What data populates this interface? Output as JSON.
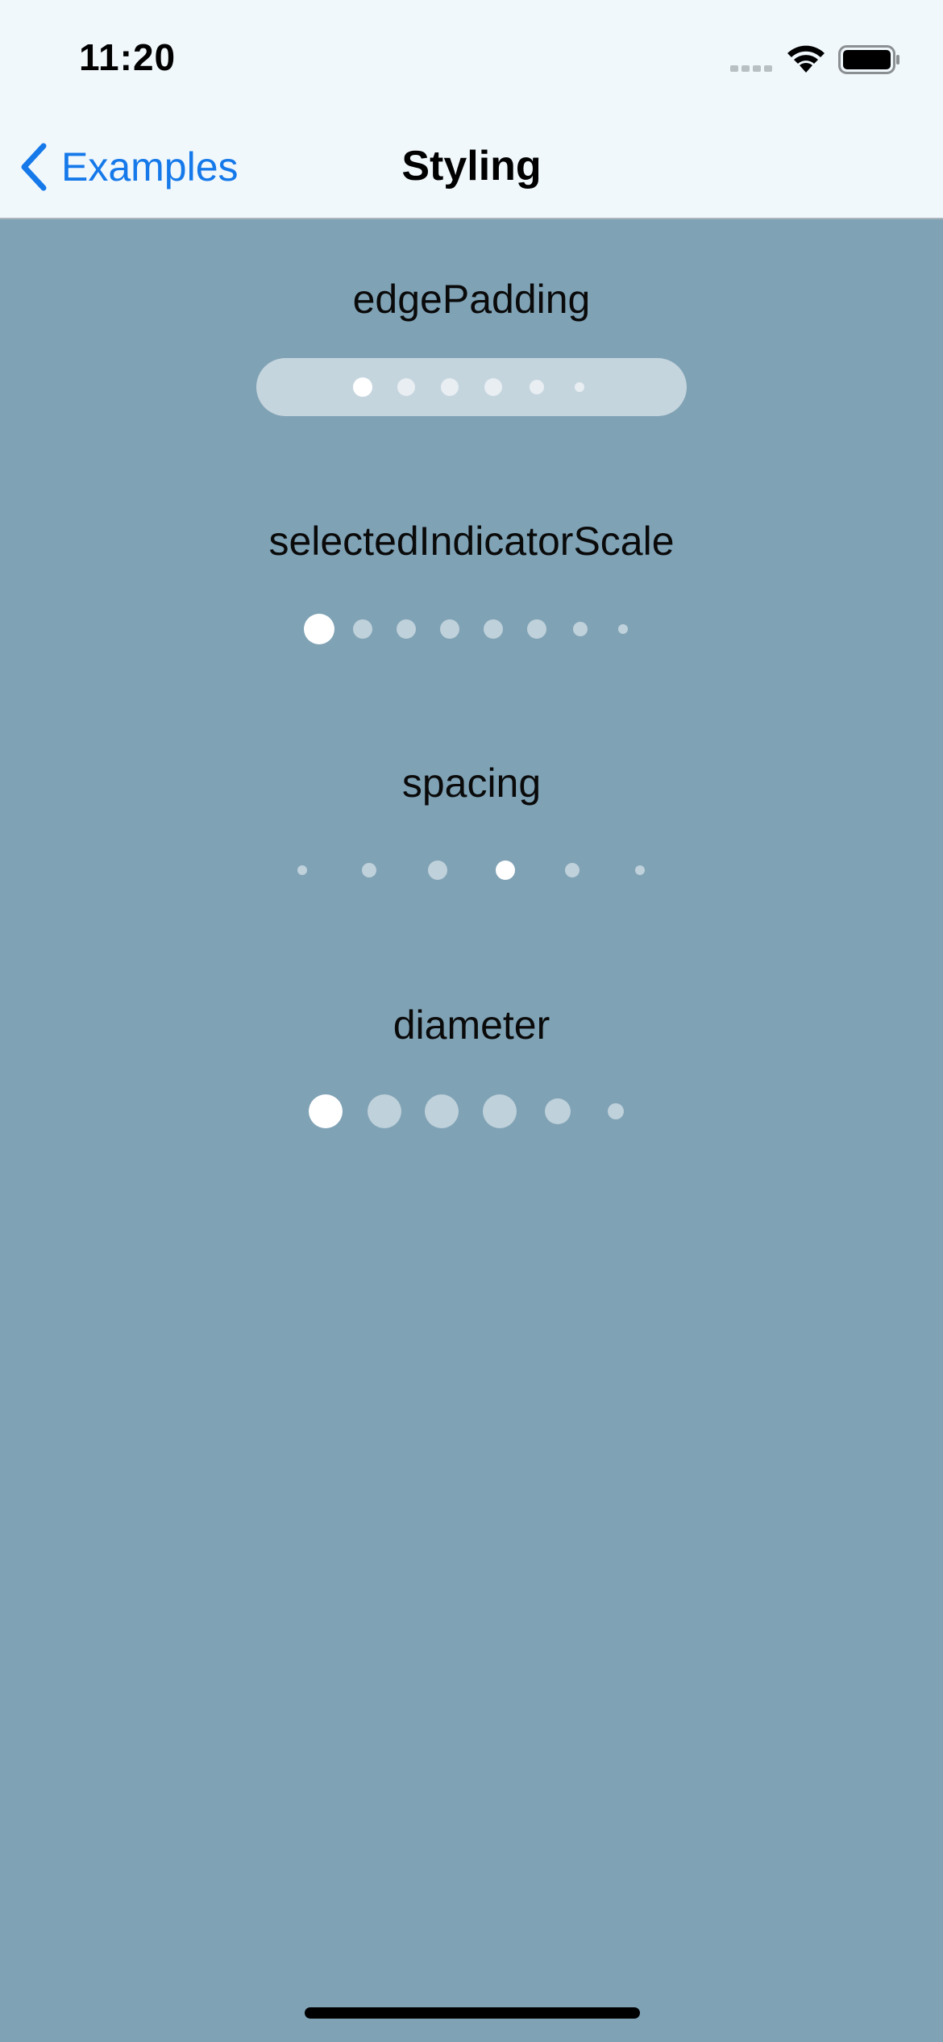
{
  "status_bar": {
    "time": "11:20",
    "icons": [
      "signal-icon",
      "wifi-icon",
      "battery-icon"
    ]
  },
  "nav": {
    "back_label": "Examples",
    "title": "Styling"
  },
  "sections": [
    {
      "title": "edgePadding",
      "dot_count": 6,
      "selected_index": 0,
      "has_background": true
    },
    {
      "title": "selectedIndicatorScale",
      "dot_count": 8,
      "selected_index": 0,
      "has_background": false
    },
    {
      "title": "spacing",
      "dot_count": 6,
      "selected_index": 3,
      "has_background": false
    },
    {
      "title": "diameter",
      "dot_count": 6,
      "selected_index": 0,
      "has_background": false
    }
  ],
  "colors": {
    "background": "#7fa2b5",
    "nav_background": "#f1f8fc",
    "accent": "#1579ea",
    "selected_dot": "#ffffff"
  }
}
